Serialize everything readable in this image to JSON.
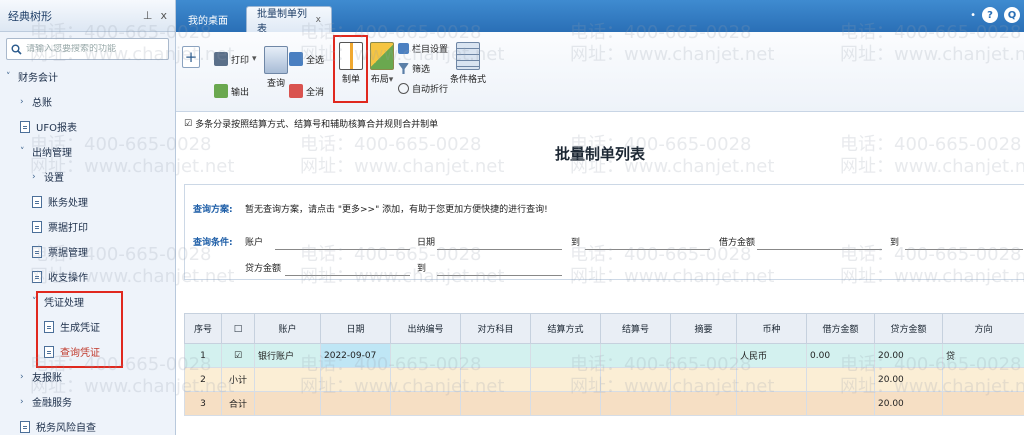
{
  "sidebar": {
    "title": "经典树形",
    "pin": "⊥",
    "close": "x",
    "search_placeholder": "请输入您要搜索的功能",
    "items": [
      {
        "label": "财务会计",
        "marker": "˅"
      },
      {
        "label": "总账",
        "marker": "›"
      },
      {
        "label": "UFO报表"
      },
      {
        "label": "出纳管理",
        "marker": "˅"
      },
      {
        "label": "设置",
        "marker": "›"
      },
      {
        "label": "账务处理"
      },
      {
        "label": "票据打印"
      },
      {
        "label": "票据管理"
      },
      {
        "label": "收支操作"
      },
      {
        "label": "凭证处理",
        "marker": "˅"
      },
      {
        "label": "生成凭证"
      },
      {
        "label": "查询凭证"
      },
      {
        "label": "友报账",
        "marker": "›"
      },
      {
        "label": "金融服务",
        "marker": "›"
      },
      {
        "label": "税务风险自查"
      }
    ]
  },
  "tabs": [
    {
      "label": "我的桌面"
    },
    {
      "label": "批量制单列表",
      "close": "x"
    }
  ],
  "topright": {
    "dot": "•",
    "help": "?",
    "search": "Q"
  },
  "toolbar": {
    "add": "+",
    "print": "打印",
    "print_arrow": "▾",
    "export": "输出",
    "query": "查询",
    "select_all": "全选",
    "deselect_all": "全消",
    "make_voucher": "制单",
    "layout": "布局",
    "layout_arrow": "▾",
    "column_settings": "栏目设置",
    "filter": "筛选",
    "auto_wrap": "自动折行",
    "conditional_format": "条件格式"
  },
  "option": {
    "checked": "☑",
    "label": "多条分录按照结算方式、结算号和辅助核算合并规则合并制单"
  },
  "page_title": "批量制单列表",
  "query": {
    "scheme_label": "查询方案:",
    "scheme_text": "暂无查询方案，请点击 \"更多>>\" 添加，有助于您更加方便快捷的进行查询!",
    "condition_label": "查询条件:",
    "account": "账户",
    "date": "日期",
    "to1": "到",
    "debit_amount": "借方金额",
    "to2": "到",
    "credit_amount": "贷方金额",
    "to3": "到"
  },
  "grid": {
    "columns": [
      "序号",
      "□",
      "账户",
      "日期",
      "出纳编号",
      "对方科目",
      "结算方式",
      "结算号",
      "摘要",
      "币种",
      "借方金额",
      "贷方金额",
      "方向"
    ],
    "rows": [
      [
        "1",
        "☑",
        "银行账户",
        "2022-09-07",
        "",
        "",
        "",
        "",
        "",
        "人民币",
        "0.00",
        "20.00",
        "贷"
      ],
      [
        "2",
        "小计",
        "",
        "",
        "",
        "",
        "",
        "",
        "",
        "",
        "",
        "20.00",
        ""
      ],
      [
        "3",
        "合计",
        "",
        "",
        "",
        "",
        "",
        "",
        "",
        "",
        "",
        "20.00",
        ""
      ]
    ]
  },
  "watermark": {
    "phone": "电话：400-665-0028",
    "site": "网址：www.chanjet.net"
  },
  "colors": {
    "tabbar": "#2a6fb6",
    "highlight_box": "#e0281e",
    "row_selected": "#d3f1ef",
    "row_subtotal": "#fbeed5",
    "row_total": "#f6dfc4"
  }
}
